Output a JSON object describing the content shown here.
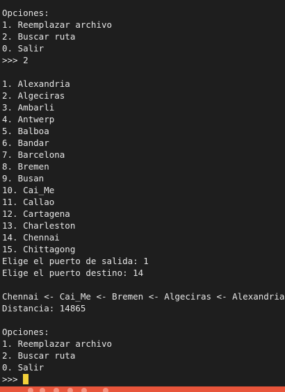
{
  "terminal": {
    "lines": [
      "Opciones:",
      "1. Reemplazar archivo",
      "2. Buscar ruta",
      "0. Salir",
      ">>> 2",
      "",
      "1. Alexandria",
      "2. Algeciras",
      "3. Ambarli",
      "4. Antwerp",
      "5. Balboa",
      "6. Bandar",
      "7. Barcelona",
      "8. Bremen",
      "9. Busan",
      "10. Cai_Me",
      "11. Callao",
      "12. Cartagena",
      "13. Charleston",
      "14. Chennai",
      "15. Chittagong",
      "Elige el puerto de salida: 1",
      "Elige el puerto destino: 14",
      "",
      "Chennai <- Cai_Me <- Bremen <- Algeciras <- Alexandria",
      "Distancia: 14865",
      "",
      "Opciones:",
      "1. Reemplazar archivo",
      "2. Buscar ruta",
      "0. Salir"
    ],
    "prompt": ">>> ",
    "cursor_color": "#f2d13a"
  },
  "status_bar": {
    "color": "#e8553b"
  }
}
